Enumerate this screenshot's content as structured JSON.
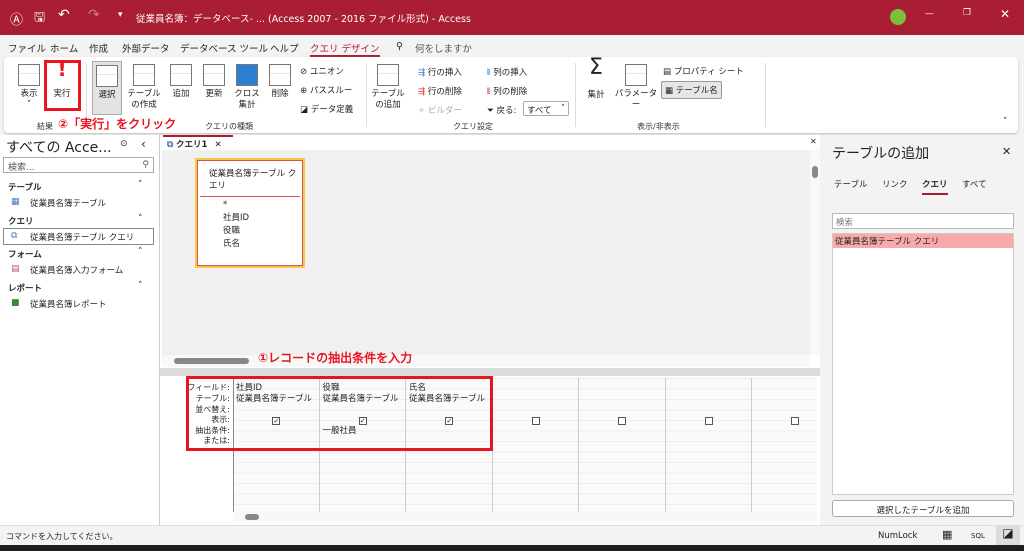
{
  "titlebar": {
    "title": "従業員名簿：データベース- ... (Access 2007 - 2016 ファイル形式) - Access",
    "accent": "#a91e32"
  },
  "menu": [
    "ファイル",
    "ホーム",
    "作成",
    "外部データ",
    "データベース ツール",
    "ヘルプ",
    "クエリ デザイン"
  ],
  "search_prompt": "何をしますか",
  "ribbon": {
    "results": {
      "view": "表示",
      "run": "実行",
      "group": "結果"
    },
    "query_type": {
      "select": "選択",
      "make_table": "テーブルの作成",
      "append": "追加",
      "update": "更新",
      "crosstab": "クロス集計",
      "delete": "削除",
      "union": "ユニオン",
      "passthrough": "パススルー",
      "data_definition": "データ定義",
      "group": "クエリの種類"
    },
    "setup": {
      "add_table": "テーブルの追加",
      "insert_rows": "行の挿入",
      "delete_rows": "行の削除",
      "builder": "ビルダー",
      "insert_cols": "列の挿入",
      "delete_cols": "列の削除",
      "return": "戻る:",
      "return_value": "すべて",
      "group": "クエリ設定"
    },
    "show_hide": {
      "totals": "集計",
      "parameters": "パラメーター",
      "property_sheet": "プロパティ シート",
      "table_names": "テーブル名",
      "group": "表示/非表示"
    }
  },
  "annotations": {
    "step1": "①レコードの抽出条件を入力",
    "step2": "②「実行」をクリック"
  },
  "nav": {
    "title": "すべての Acce...",
    "search_placeholder": "検索...",
    "sections": [
      {
        "label": "テーブル",
        "items": [
          "従業員名簿テーブル"
        ]
      },
      {
        "label": "クエリ",
        "items": [
          "従業員名簿テーブル クエリ"
        ]
      },
      {
        "label": "フォーム",
        "items": [
          "従業員名簿入力フォーム"
        ]
      },
      {
        "label": "レポート",
        "items": [
          "従業員名簿レポート"
        ]
      }
    ]
  },
  "doc": {
    "tab": "クエリ1",
    "fieldlist": {
      "title": "従業員名簿テーブル クエリ",
      "fields": [
        "*",
        "社員ID",
        "役職",
        "氏名"
      ]
    }
  },
  "grid": {
    "row_labels": [
      "フィールド:",
      "テーブル:",
      "並べ替え:",
      "表示:",
      "抽出条件:",
      "または:"
    ],
    "columns": [
      {
        "field": "社員ID",
        "table": "従業員名簿テーブル",
        "show": true,
        "criteria": ""
      },
      {
        "field": "役職",
        "table": "従業員名簿テーブル",
        "show": true,
        "criteria": "一般社員"
      },
      {
        "field": "氏名",
        "table": "従業員名簿テーブル",
        "show": true,
        "criteria": ""
      },
      {
        "field": "",
        "table": "",
        "show": false,
        "criteria": ""
      },
      {
        "field": "",
        "table": "",
        "show": false,
        "criteria": ""
      },
      {
        "field": "",
        "table": "",
        "show": false,
        "criteria": ""
      },
      {
        "field": "",
        "table": "",
        "show": false,
        "criteria": ""
      }
    ]
  },
  "right": {
    "title": "テーブルの追加",
    "tabs": [
      "テーブル",
      "リンク",
      "クエリ",
      "すべて"
    ],
    "active_tab": "クエリ",
    "search_placeholder": "検索",
    "items": [
      "従業員名簿テーブル クエリ"
    ],
    "add_button": "選択したテーブルを追加"
  },
  "status": {
    "message": "コマンドを入力してください。",
    "numlock": "NumLock",
    "sql": "SQL"
  }
}
